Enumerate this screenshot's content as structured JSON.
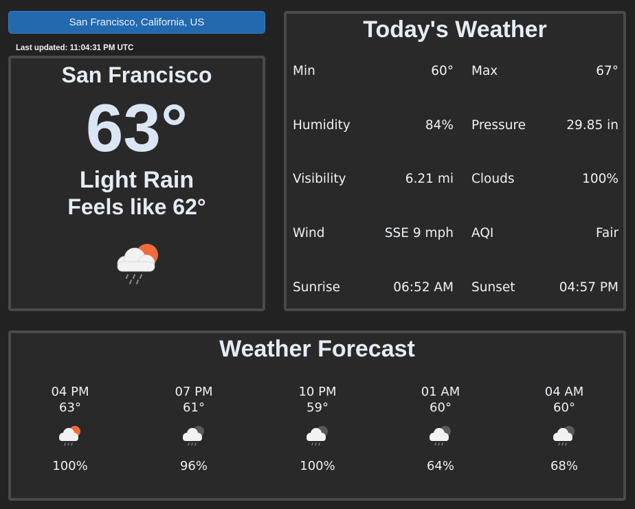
{
  "location_button": "San Francisco, California, US",
  "last_updated": "Last updated: 11:04:31 PM UTC",
  "current": {
    "city": "San Francisco",
    "temperature": "63°",
    "condition": "Light Rain",
    "feels_like": "Feels like 62°",
    "icon": "rain-cloud-sun-icon"
  },
  "today": {
    "title": "Today's Weather",
    "stats": [
      {
        "label": "Min",
        "value": "60°"
      },
      {
        "label": "Max",
        "value": "67°"
      },
      {
        "label": "Humidity",
        "value": "84%"
      },
      {
        "label": "Pressure",
        "value": "29.85 in"
      },
      {
        "label": "Visibility",
        "value": "6.21 mi"
      },
      {
        "label": "Clouds",
        "value": "100%"
      },
      {
        "label": "Wind",
        "value": "SSE 9 mph"
      },
      {
        "label": "AQI",
        "value": "Fair"
      },
      {
        "label": "Sunrise",
        "value": "06:52 AM"
      },
      {
        "label": "Sunset",
        "value": "04:57 PM"
      }
    ]
  },
  "forecast": {
    "title": "Weather Forecast",
    "items": [
      {
        "time": "04 PM",
        "temp": "63°",
        "pop": "100%",
        "icon": "rain-cloud-sun-icon"
      },
      {
        "time": "07 PM",
        "temp": "61°",
        "pop": "96%",
        "icon": "rain-cloud-moon-icon"
      },
      {
        "time": "10 PM",
        "temp": "59°",
        "pop": "100%",
        "icon": "rain-cloud-moon-icon"
      },
      {
        "time": "01 AM",
        "temp": "60°",
        "pop": "64%",
        "icon": "rain-cloud-moon-icon"
      },
      {
        "time": "04 AM",
        "temp": "60°",
        "pop": "68%",
        "icon": "rain-cloud-moon-icon"
      }
    ]
  },
  "colors": {
    "background": "#222222",
    "panel": "#292929",
    "panel_border": "#4a4a4a",
    "button": "#2369ad",
    "sun": "#f26b3a",
    "moon": "#5a5a5a",
    "cloud": "#f2f2f2"
  }
}
